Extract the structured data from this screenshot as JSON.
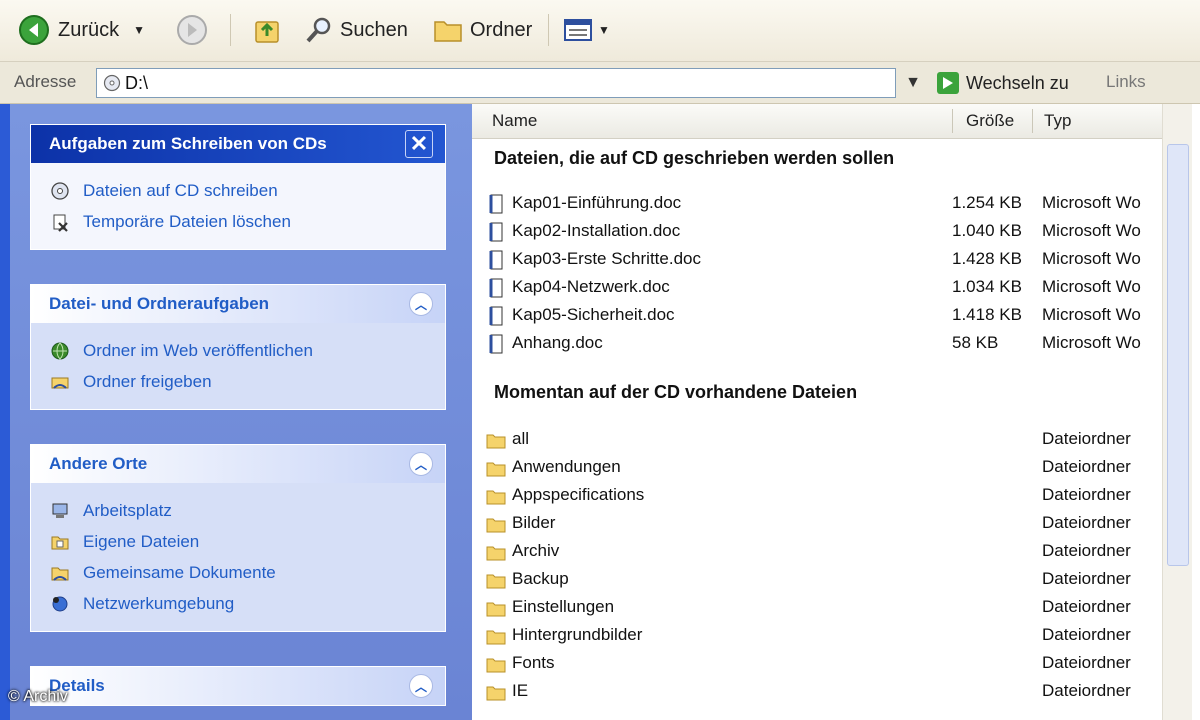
{
  "toolbar": {
    "back_label": "Zurück",
    "search_label": "Suchen",
    "folders_label": "Ordner"
  },
  "address": {
    "label": "Adresse",
    "value": "D:\\",
    "go_label": "Wechseln zu",
    "links_label": "Links"
  },
  "taskpane": {
    "panels": [
      {
        "title": "Aufgaben zum Schreiben von CDs",
        "items": [
          {
            "label": "Dateien auf CD schreiben",
            "icon": "cd-write-icon"
          },
          {
            "label": "Temporäre Dateien löschen",
            "icon": "delete-icon"
          }
        ]
      },
      {
        "title": "Datei- und Ordneraufgaben",
        "items": [
          {
            "label": "Ordner im Web veröffentlichen",
            "icon": "web-publish-icon"
          },
          {
            "label": "Ordner freigeben",
            "icon": "share-icon"
          }
        ]
      },
      {
        "title": "Andere Orte",
        "items": [
          {
            "label": "Arbeitsplatz",
            "icon": "computer-icon"
          },
          {
            "label": "Eigene Dateien",
            "icon": "my-documents-icon"
          },
          {
            "label": "Gemeinsame Dokumente",
            "icon": "shared-documents-icon"
          },
          {
            "label": "Netzwerkumgebung",
            "icon": "network-icon"
          }
        ]
      },
      {
        "title": "Details",
        "items": []
      }
    ]
  },
  "filelist": {
    "columns": {
      "name": "Name",
      "size": "Größe",
      "type": "Typ"
    },
    "groups": [
      {
        "title": "Dateien, die auf CD geschrieben werden sollen",
        "rows": [
          {
            "name": "Kap01-Einführung.doc",
            "size": "1.254 KB",
            "type": "Microsoft Wo"
          },
          {
            "name": "Kap02-Installation.doc",
            "size": "1.040 KB",
            "type": "Microsoft Wo"
          },
          {
            "name": "Kap03-Erste Schritte.doc",
            "size": "1.428 KB",
            "type": "Microsoft Wo"
          },
          {
            "name": "Kap04-Netzwerk.doc",
            "size": "1.034 KB",
            "type": "Microsoft Wo"
          },
          {
            "name": "Kap05-Sicherheit.doc",
            "size": "1.418 KB",
            "type": "Microsoft Wo"
          },
          {
            "name": "Anhang.doc",
            "size": "58 KB",
            "type": "Microsoft Wo"
          }
        ]
      },
      {
        "title": "Momentan auf der CD vorhandene Dateien",
        "rows": [
          {
            "name": "all",
            "size": "",
            "type": "Dateiordner"
          },
          {
            "name": "Anwendungen",
            "size": "",
            "type": "Dateiordner"
          },
          {
            "name": "Appspecifications",
            "size": "",
            "type": "Dateiordner"
          },
          {
            "name": "Bilder",
            "size": "",
            "type": "Dateiordner"
          },
          {
            "name": "Archiv",
            "size": "",
            "type": "Dateiordner"
          },
          {
            "name": "Backup",
            "size": "",
            "type": "Dateiordner"
          },
          {
            "name": "Einstellungen",
            "size": "",
            "type": "Dateiordner"
          },
          {
            "name": "Hintergrundbilder",
            "size": "",
            "type": "Dateiordner"
          },
          {
            "name": "Fonts",
            "size": "",
            "type": "Dateiordner"
          },
          {
            "name": "IE",
            "size": "",
            "type": "Dateiordner"
          }
        ]
      }
    ]
  },
  "watermark": "© Archiv",
  "colors": {
    "taskpane_bg": "#7a96df",
    "panel_header_special": "#0c32a8",
    "link_text": "#215dc6",
    "folder_yellow": "#f5d36b"
  }
}
